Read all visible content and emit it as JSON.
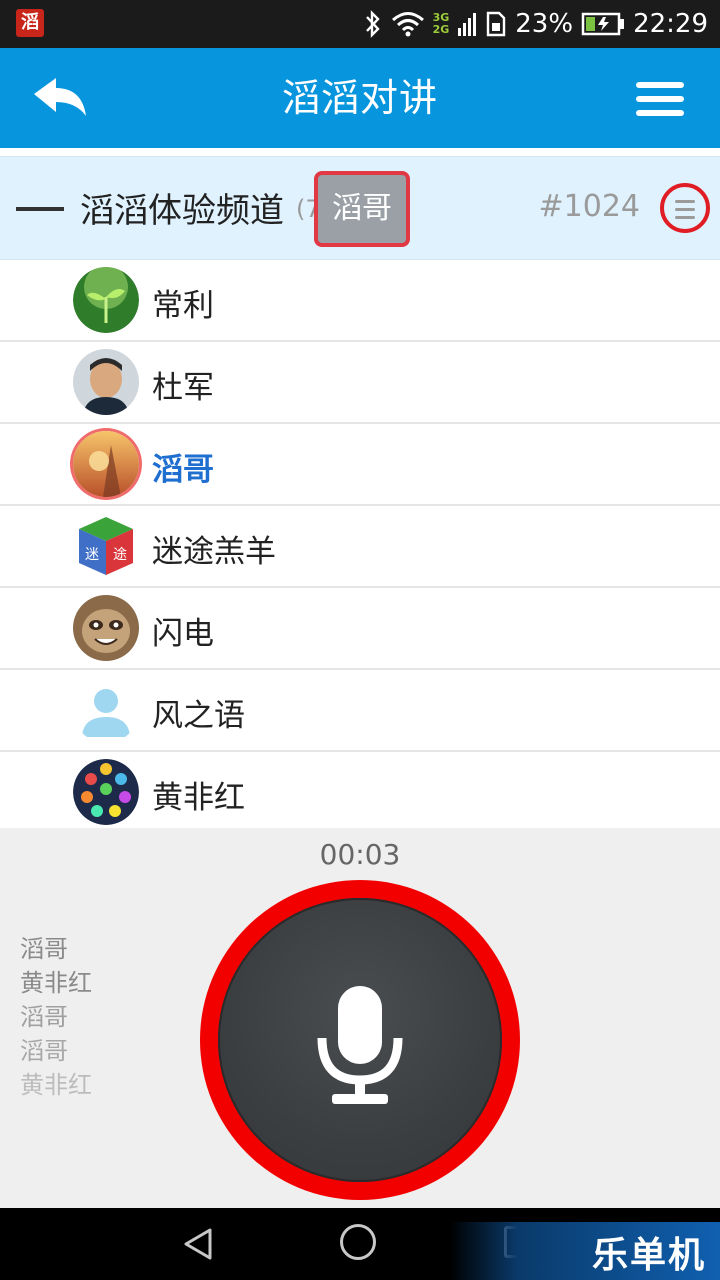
{
  "status_bar": {
    "app_badge": "滔",
    "network_3g": "3G",
    "network_2g": "2G",
    "battery_percent": "23%",
    "time": "22:29",
    "icons": [
      "bluetooth-icon",
      "wifi-icon",
      "signal-icon",
      "sim-icon",
      "battery-icon"
    ]
  },
  "header": {
    "title": "滔滔对讲",
    "back_icon": "back-arrow-icon",
    "menu_icon": "hamburger-menu-icon"
  },
  "channel": {
    "name": "滔滔体验频道",
    "count": "(7)",
    "speaker": "滔哥",
    "id": "#1024",
    "menu_icon": "channel-menu-icon"
  },
  "members": [
    {
      "name": "常利",
      "avatar": "sprout-avatar",
      "active": false
    },
    {
      "name": "杜军",
      "avatar": "photo-avatar",
      "active": false
    },
    {
      "name": "滔哥",
      "avatar": "sunset-avatar",
      "active": true
    },
    {
      "name": "迷途羔羊",
      "avatar": "cube-avatar",
      "active": false
    },
    {
      "name": "闪电",
      "avatar": "sloth-avatar",
      "active": false
    },
    {
      "name": "风之语",
      "avatar": "default-user-avatar",
      "active": false
    },
    {
      "name": "黄非红",
      "avatar": "dots-avatar",
      "active": false
    }
  ],
  "talk_panel": {
    "timer": "00:03",
    "history": [
      "滔哥",
      "黄非红",
      "滔哥",
      "滔哥",
      "黄非红"
    ],
    "history_colors": [
      "#8a8a8a",
      "#8a8a8a",
      "#a0a0a0",
      "#a8a8a8",
      "#bcbcbc"
    ],
    "mic_icon": "microphone-icon",
    "ring_color": "#f20000"
  },
  "nav_bar": {
    "watermark": "乐单机"
  }
}
